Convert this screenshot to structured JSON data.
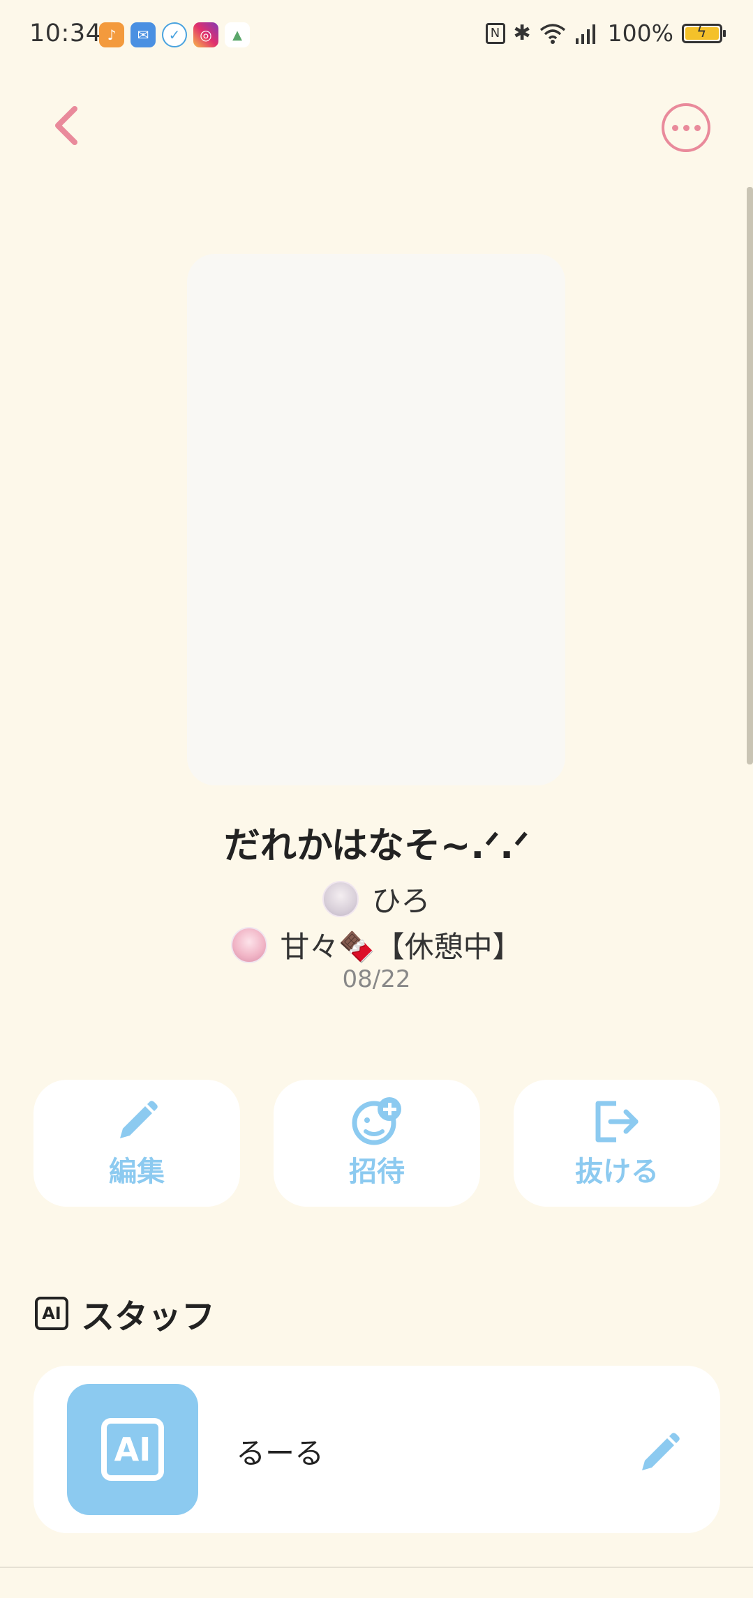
{
  "status_bar": {
    "time": "10:34",
    "battery": "100%",
    "app_icons": [
      "music-app-icon",
      "mail-app-icon",
      "clock-check-app-icon",
      "instagram-icon",
      "app-icon"
    ]
  },
  "header": {
    "back_icon": "chevron-left-icon",
    "more_icon": "more-icon"
  },
  "room": {
    "title": "だれかはなそ~.ᐟ.ᐟ",
    "members": [
      {
        "name": "ひろ"
      },
      {
        "name": "甘々🍫【休憩中】"
      }
    ],
    "date": "08/22"
  },
  "actions": [
    {
      "label": "編集",
      "icon": "pencil-icon"
    },
    {
      "label": "招待",
      "icon": "invite-icon"
    },
    {
      "label": "抜ける",
      "icon": "exit-icon"
    }
  ],
  "staff": {
    "section_title": "スタッフ",
    "badge": "AI",
    "items": [
      {
        "name": "るーる",
        "avatar_text": "AI"
      }
    ]
  },
  "colors": {
    "background": "#fdf8ea",
    "accent_pink": "#e98a9b",
    "accent_blue": "#8ccaf0"
  }
}
